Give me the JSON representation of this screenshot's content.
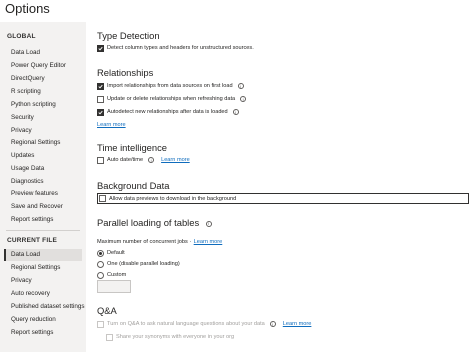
{
  "window": {
    "title": "Options"
  },
  "sidebar": {
    "global_header": "GLOBAL",
    "global_items": [
      "Data Load",
      "Power Query Editor",
      "DirectQuery",
      "R scripting",
      "Python scripting",
      "Security",
      "Privacy",
      "Regional Settings",
      "Updates",
      "Usage Data",
      "Diagnostics",
      "Preview features",
      "Save and Recover",
      "Report settings"
    ],
    "current_header": "CURRENT FILE",
    "current_items": [
      "Data Load",
      "Regional Settings",
      "Privacy",
      "Auto recovery",
      "Published dataset settings",
      "Query reduction",
      "Report settings"
    ],
    "selected": "Data Load"
  },
  "type_detection": {
    "title": "Type Detection",
    "detect_label": "Detect column types and headers for unstructured sources.",
    "detect_checked": true
  },
  "relationships": {
    "title": "Relationships",
    "import_label": "Import relationships from data sources on first load",
    "import_checked": true,
    "update_label": "Update or delete relationships when refreshing data",
    "update_checked": false,
    "autodetect_label": "Autodetect new relationships after data is loaded",
    "autodetect_checked": true,
    "learn_more": "Learn more"
  },
  "time_intelligence": {
    "title": "Time intelligence",
    "auto_date_label": "Auto date/time",
    "auto_date_checked": false,
    "learn_more": "Learn more"
  },
  "background_data": {
    "title": "Background Data",
    "allow_label": "Allow data previews to download in the background",
    "allow_checked": false
  },
  "parallel_loading": {
    "title": "Parallel loading of tables",
    "max_jobs_label": "Maximum number of concurrent jobs",
    "learn_more": "Learn more",
    "options": [
      "Default",
      "One (disable parallel loading)",
      "Custom"
    ],
    "selected": "Default",
    "custom_value": ""
  },
  "qa": {
    "title": "Q&A",
    "turn_on_label": "Turn on Q&A to ask natural language questions about your data",
    "turn_on_checked": false,
    "learn_more": "Learn more",
    "share_label": "Share your synonyms with everyone in your org",
    "share_checked": false
  },
  "colors": {
    "link": "#0f6cbd",
    "checked": "#323130",
    "sidebar_bg": "#f3f2f1"
  }
}
